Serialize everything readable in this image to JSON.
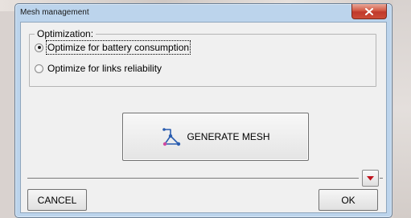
{
  "window": {
    "title": "Mesh management",
    "close_icon": "close-icon"
  },
  "optimization": {
    "legend": "Optimization:",
    "options": [
      {
        "label": "Optimize for battery consumption",
        "selected": true
      },
      {
        "label": "Optimize for links reliability",
        "selected": false
      }
    ]
  },
  "generate": {
    "label": "GENERATE MESH",
    "icon": "mesh-network-icon"
  },
  "footer": {
    "expand_icon": "dropdown-arrow-icon",
    "cancel_label": "CANCEL",
    "ok_label": "OK"
  },
  "colors": {
    "close_button": "#c0392b",
    "expand_arrow": "#c0141e",
    "mesh_icon_line": "#2a5db0",
    "mesh_icon_accent": "#d04aa0"
  }
}
